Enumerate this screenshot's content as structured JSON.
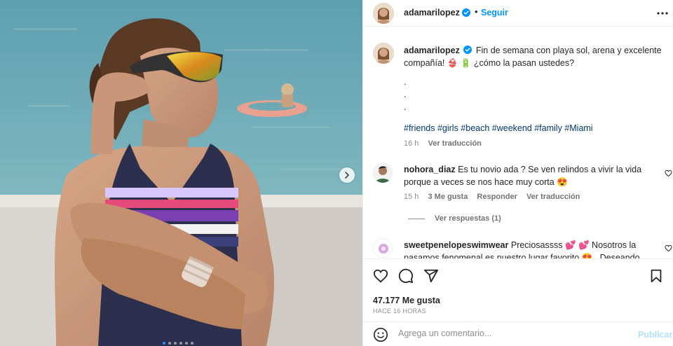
{
  "header": {
    "username": "adamarilopez",
    "separator": "•",
    "follow_label": "Seguir"
  },
  "caption": {
    "username": "adamarilopez",
    "text": "Fin de semana con playa sol, arena y excelente compañía! 👙 🔋 ¿cómo la pasan ustedes?",
    "dots": [
      ".",
      ".",
      "."
    ],
    "hashtags": "#friends #girls #beach #weekend #family #Miami",
    "time": "16 h",
    "translate_label": "Ver traducción"
  },
  "comments": [
    {
      "username": "nohora_diaz",
      "text": "Es tu novio ada ? Se ven relindos a vivir la vida porque a veces se nos hace muy corta 😍",
      "time": "15 h",
      "likes": "3 Me gusta",
      "reply_label": "Responder",
      "translate_label": "Ver traducción",
      "view_replies": "Ver respuestas (1)"
    },
    {
      "username": "sweetpenelopeswimwear",
      "text": "Preciosassss 💕 💕 Nosotros la pasamos fenomenal es nuestro lugar favorito 😍 . Deseando"
    }
  ],
  "actions": {
    "icons": [
      "heart-icon",
      "comment-icon",
      "share-icon",
      "bookmark-icon"
    ],
    "likes": "47.177 Me gusta",
    "time": "HACE 16 HORAS"
  },
  "add_comment": {
    "placeholder": "Agrega un comentario...",
    "publish_label": "Publicar"
  },
  "colors": {
    "accent": "#0095f6",
    "link": "#00376b",
    "muted": "#8e8e8e",
    "publish_disabled": "#b2dffc"
  },
  "carousel": {
    "slides": 6,
    "active": 1
  }
}
